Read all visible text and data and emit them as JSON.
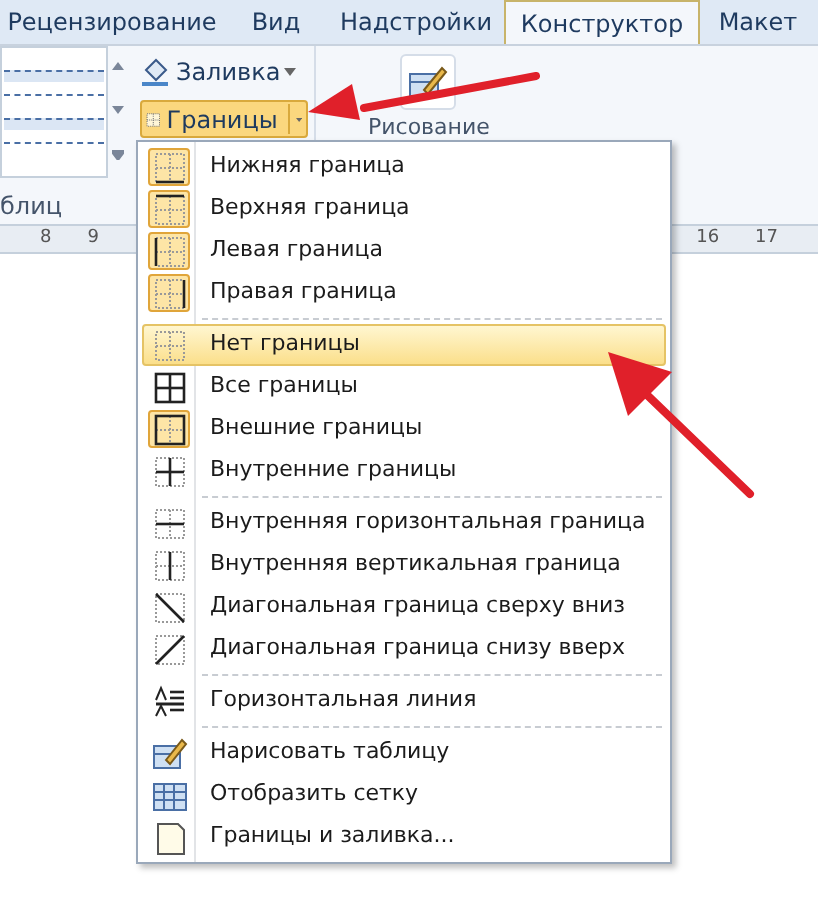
{
  "tabs": [
    {
      "label": "Рецензирование",
      "selected": false
    },
    {
      "label": "Вид",
      "selected": false
    },
    {
      "label": "Надстройки",
      "selected": false
    },
    {
      "label": "Конструктор",
      "selected": true
    },
    {
      "label": "Макет",
      "selected": false
    }
  ],
  "ribbon": {
    "fill_button": "Заливка",
    "borders_button": {
      "label": "Границы",
      "pressed": true
    },
    "draw_label": "Рисование",
    "group_label": "блиц"
  },
  "ruler": {
    "left_numbers": [
      "8",
      "9"
    ],
    "right_numbers": [
      "16",
      "17"
    ]
  },
  "menu": {
    "groups": [
      [
        {
          "kind": "bottom",
          "label": "Нижняя граница",
          "checked": true,
          "selected": false
        },
        {
          "kind": "top",
          "label": "Верхняя граница",
          "checked": true,
          "selected": false
        },
        {
          "kind": "left",
          "label": "Левая граница",
          "checked": true,
          "selected": false
        },
        {
          "kind": "right",
          "label": "Правая граница",
          "checked": true,
          "selected": false
        }
      ],
      [
        {
          "kind": "none",
          "label": "Нет границы",
          "checked": false,
          "selected": true
        },
        {
          "kind": "all",
          "label": "Все границы",
          "checked": false,
          "selected": false
        },
        {
          "kind": "outside",
          "label": "Внешние границы",
          "checked": true,
          "selected": false
        },
        {
          "kind": "inside",
          "label": "Внутренние границы",
          "checked": false,
          "selected": false
        }
      ],
      [
        {
          "kind": "inside_h",
          "label": "Внутренняя горизонтальная граница",
          "checked": false,
          "selected": false
        },
        {
          "kind": "inside_v",
          "label": "Внутренняя вертикальная граница",
          "checked": false,
          "selected": false
        },
        {
          "kind": "diag_down",
          "label": "Диагональная граница сверху вниз",
          "checked": false,
          "selected": false
        },
        {
          "kind": "diag_up",
          "label": "Диагональная граница снизу вверх",
          "checked": false,
          "selected": false
        }
      ],
      [
        {
          "kind": "hline",
          "label": "Горизонтальная линия",
          "checked": false,
          "selected": false
        }
      ],
      [
        {
          "kind": "draw",
          "label": "Нарисовать таблицу",
          "checked": false,
          "selected": false
        },
        {
          "kind": "grid",
          "label": "Отобразить сетку",
          "checked": false,
          "selected": false
        },
        {
          "kind": "dialog",
          "label": "Границы и заливка...",
          "checked": false,
          "selected": false
        }
      ]
    ]
  }
}
